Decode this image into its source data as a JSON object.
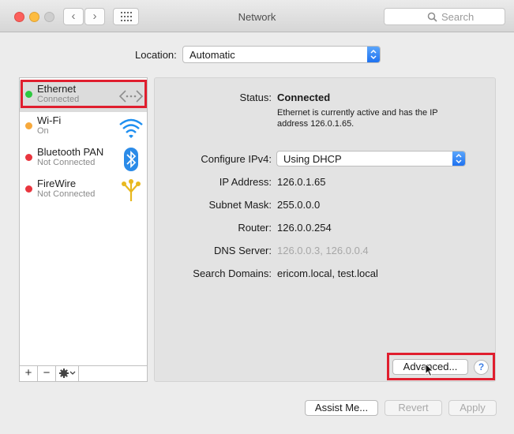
{
  "window": {
    "title": "Network",
    "search_placeholder": "Search",
    "back_glyph": "‹",
    "forward_glyph": "›"
  },
  "location": {
    "label": "Location:",
    "value": "Automatic"
  },
  "services": [
    {
      "name": "Ethernet",
      "status": "Connected",
      "dot_color": "#2ec840",
      "icon": "ethernet-arrows-icon"
    },
    {
      "name": "Wi-Fi",
      "status": "On",
      "dot_color": "#f7a93c",
      "icon": "wifi-icon"
    },
    {
      "name": "Bluetooth PAN",
      "status": "Not Connected",
      "dot_color": "#e9353e",
      "icon": "bluetooth-icon"
    },
    {
      "name": "FireWire",
      "status": "Not Connected",
      "dot_color": "#e9353e",
      "icon": "firewire-icon"
    }
  ],
  "sidebar_tools": {
    "add": "+",
    "remove": "−"
  },
  "details": {
    "status_label": "Status:",
    "status_value": "Connected",
    "status_description_line1": "Ethernet is currently active and has the IP",
    "status_description_line2": "address 126.0.1.65.",
    "configure_label": "Configure IPv4:",
    "configure_value": "Using DHCP",
    "ip_label": "IP Address:",
    "ip_value": "126.0.1.65",
    "subnet_label": "Subnet Mask:",
    "subnet_value": "255.0.0.0",
    "router_label": "Router:",
    "router_value": "126.0.0.254",
    "dns_label": "DNS Server:",
    "dns_value": "126.0.0.3, 126.0.0.4",
    "domains_label": "Search Domains:",
    "domains_value": "ericom.local, test.local"
  },
  "buttons": {
    "advanced": "Advanced...",
    "help": "?",
    "assist": "Assist Me...",
    "revert": "Revert",
    "apply": "Apply"
  },
  "colors": {
    "highlight": "#e01e2e",
    "accent": "#1f72f0"
  }
}
